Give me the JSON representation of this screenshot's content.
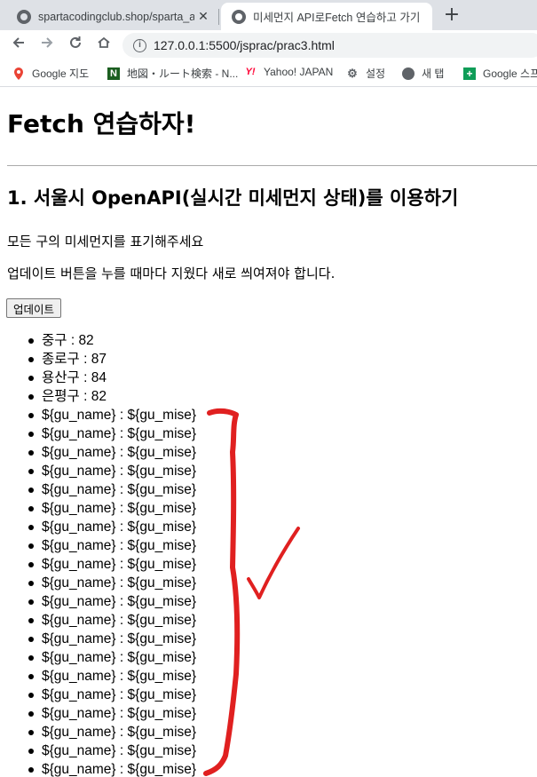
{
  "browser": {
    "tabs": [
      {
        "title": "spartacodingclub.shop/sparta_api",
        "active": false
      },
      {
        "title": "미세먼지 API로Fetch 연습하고 가기",
        "active": true
      }
    ],
    "new_tab_label": "+",
    "close_label": "✕",
    "url": "127.0.0.1:5500/jsprac/prac3.html",
    "bookmarks": [
      {
        "label": "Google 지도",
        "icon": "google-maps-icon"
      },
      {
        "label": "地図・ルート検索 - N...",
        "icon": "navitime-icon"
      },
      {
        "label": "Yahoo! JAPAN",
        "icon": "yahoo-icon"
      },
      {
        "label": "설정",
        "icon": "gear-icon"
      },
      {
        "label": "새 탭",
        "icon": "globe-icon"
      },
      {
        "label": "Google 스프레",
        "icon": "google-sheets-icon"
      }
    ]
  },
  "page": {
    "title": "Fetch 연습하자!",
    "section_title": "1. 서울시 OpenAPI(실시간 미세먼지 상태)를 이용하기",
    "instruction_1": "모든 구의 미세먼지를 표기해주세요",
    "instruction_2": "업데이트 버튼을 누를 때마다 지웠다 새로 씌여져야 합니다.",
    "update_button": "업데이트",
    "list_items": [
      "중구 : 82",
      "종로구 : 87",
      "용산구 : 84",
      "은평구 : 82",
      "${gu_name} : ${gu_mise}",
      "${gu_name} : ${gu_mise}",
      "${gu_name} : ${gu_mise}",
      "${gu_name} : ${gu_mise}",
      "${gu_name} : ${gu_mise}",
      "${gu_name} : ${gu_mise}",
      "${gu_name} : ${gu_mise}",
      "${gu_name} : ${gu_mise}",
      "${gu_name} : ${gu_mise}",
      "${gu_name} : ${gu_mise}",
      "${gu_name} : ${gu_mise}",
      "${gu_name} : ${gu_mise}",
      "${gu_name} : ${gu_mise}",
      "${gu_name} : ${gu_mise}",
      "${gu_name} : ${gu_mise}",
      "${gu_name} : ${gu_mise}",
      "${gu_name} : ${gu_mise}",
      "${gu_name} : ${gu_mise}",
      "${gu_name} : ${gu_mise}",
      "${gu_name} : ${gu_mise}"
    ]
  },
  "annotation_color": "#e02020"
}
